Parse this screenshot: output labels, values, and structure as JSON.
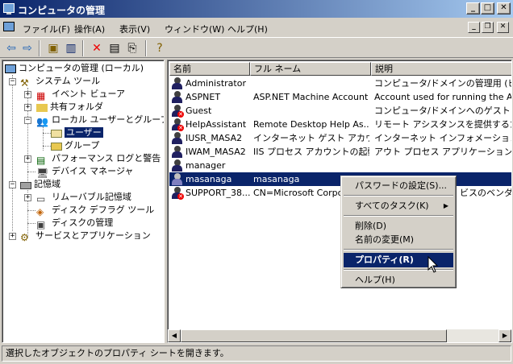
{
  "window": {
    "title": "コンピュータの管理"
  },
  "menu": {
    "items": [
      "ファイル(F)",
      "操作(A)",
      "表示(V)",
      "ウィンドウ(W)",
      "ヘルプ(H)"
    ]
  },
  "tree": {
    "items": [
      {
        "label": "コンピュータの管理 (ローカル)"
      },
      {
        "label": "システム ツール"
      },
      {
        "label": "イベント ビューア"
      },
      {
        "label": "共有フォルダ"
      },
      {
        "label": "ローカル ユーザーとグループ"
      },
      {
        "label": "ユーザー"
      },
      {
        "label": "グループ"
      },
      {
        "label": "パフォーマンス ログと警告"
      },
      {
        "label": "デバイス マネージャ"
      },
      {
        "label": "記憶域"
      },
      {
        "label": "リムーバブル記憶域"
      },
      {
        "label": "ディスク デフラグ ツール"
      },
      {
        "label": "ディスクの管理"
      },
      {
        "label": "サービスとアプリケーション"
      }
    ]
  },
  "list": {
    "columns": [
      "名前",
      "フル ネーム",
      "説明"
    ],
    "rows": [
      {
        "name": "Administrator",
        "full": "",
        "desc": "コンピュータ/ドメインの管理用 (ビル"
      },
      {
        "name": "ASPNET",
        "full": "ASP.NET Machine Account",
        "desc": "Account used for running the AS"
      },
      {
        "name": "Guest",
        "full": "",
        "desc": "コンピュータ/ドメインへのゲスト アクセ"
      },
      {
        "name": "HelpAssistant",
        "full": "Remote Desktop Help As...",
        "desc": "リモート アシスタンスを提供するための"
      },
      {
        "name": "IUSR_MASA2",
        "full": "インターネット ゲスト アカウン...",
        "desc": "インターネット インフォメーション サー"
      },
      {
        "name": "IWAM_MASA2",
        "full": "IIS プロセス アカウントの起動",
        "desc": "アウト プロセス アプリケーションを起動"
      },
      {
        "name": "manager",
        "full": "",
        "desc": ""
      },
      {
        "name": "masanaga",
        "full": "masanaga",
        "desc": ""
      },
      {
        "name": "SUPPORT_38...",
        "full": "CN=Microsoft Corpor",
        "desc": "ビスのベンダ ア"
      }
    ]
  },
  "context_menu": {
    "items": [
      "パスワードの設定(S)...",
      "すべてのタスク(K)",
      "削除(D)",
      "名前の変更(M)",
      "プロパティ(R)",
      "ヘルプ(H)"
    ]
  },
  "status": {
    "text": "選択したオブジェクトのプロパティ シートを開きます。"
  },
  "colors": {
    "title_start": "#0a246a",
    "title_end": "#a6caf0",
    "selection": "#0a246a",
    "face": "#d4d0c8"
  }
}
